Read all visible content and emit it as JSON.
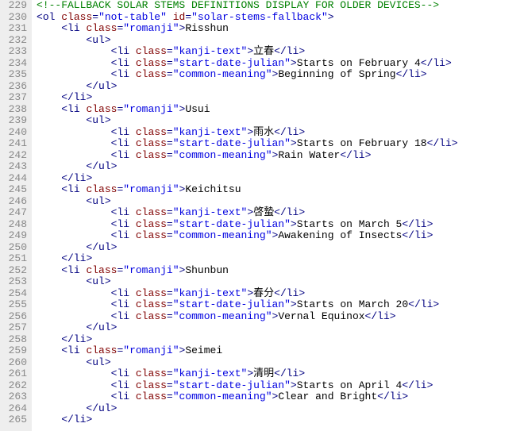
{
  "start_line_number": 229,
  "code_lines": [
    [
      {
        "t": "comment",
        "s": "<!--FALLBACK SOLAR STEMS DEFINITIONS DISPLAY FOR OLDER DEVICES-->"
      }
    ],
    [
      {
        "t": "punc",
        "s": "<"
      },
      {
        "t": "tag",
        "s": "ol"
      },
      {
        "t": "punc",
        "s": " "
      },
      {
        "t": "attr",
        "s": "class"
      },
      {
        "t": "punc",
        "s": "="
      },
      {
        "t": "str",
        "s": "\"not-table\""
      },
      {
        "t": "punc",
        "s": " "
      },
      {
        "t": "attr",
        "s": "id"
      },
      {
        "t": "punc",
        "s": "="
      },
      {
        "t": "str",
        "s": "\"solar-stems-fallback\""
      },
      {
        "t": "punc",
        "s": ">"
      }
    ],
    [
      {
        "t": "text",
        "s": "    "
      },
      {
        "t": "punc",
        "s": "<"
      },
      {
        "t": "tag",
        "s": "li"
      },
      {
        "t": "punc",
        "s": " "
      },
      {
        "t": "attr",
        "s": "class"
      },
      {
        "t": "punc",
        "s": "="
      },
      {
        "t": "str",
        "s": "\"romanji\""
      },
      {
        "t": "punc",
        "s": ">"
      },
      {
        "t": "text",
        "s": "Risshun"
      }
    ],
    [
      {
        "t": "text",
        "s": "        "
      },
      {
        "t": "punc",
        "s": "<"
      },
      {
        "t": "tag",
        "s": "ul"
      },
      {
        "t": "punc",
        "s": ">"
      }
    ],
    [
      {
        "t": "text",
        "s": "            "
      },
      {
        "t": "punc",
        "s": "<"
      },
      {
        "t": "tag",
        "s": "li"
      },
      {
        "t": "punc",
        "s": " "
      },
      {
        "t": "attr",
        "s": "class"
      },
      {
        "t": "punc",
        "s": "="
      },
      {
        "t": "str",
        "s": "\"kanji-text\""
      },
      {
        "t": "punc",
        "s": ">"
      },
      {
        "t": "text",
        "s": "立春"
      },
      {
        "t": "punc",
        "s": "</"
      },
      {
        "t": "tag",
        "s": "li"
      },
      {
        "t": "punc",
        "s": ">"
      }
    ],
    [
      {
        "t": "text",
        "s": "            "
      },
      {
        "t": "punc",
        "s": "<"
      },
      {
        "t": "tag",
        "s": "li"
      },
      {
        "t": "punc",
        "s": " "
      },
      {
        "t": "attr",
        "s": "class"
      },
      {
        "t": "punc",
        "s": "="
      },
      {
        "t": "str",
        "s": "\"start-date-julian\""
      },
      {
        "t": "punc",
        "s": ">"
      },
      {
        "t": "text",
        "s": "Starts on February 4"
      },
      {
        "t": "punc",
        "s": "</"
      },
      {
        "t": "tag",
        "s": "li"
      },
      {
        "t": "punc",
        "s": ">"
      }
    ],
    [
      {
        "t": "text",
        "s": "            "
      },
      {
        "t": "punc",
        "s": "<"
      },
      {
        "t": "tag",
        "s": "li"
      },
      {
        "t": "punc",
        "s": " "
      },
      {
        "t": "attr",
        "s": "class"
      },
      {
        "t": "punc",
        "s": "="
      },
      {
        "t": "str",
        "s": "\"common-meaning\""
      },
      {
        "t": "punc",
        "s": ">"
      },
      {
        "t": "text",
        "s": "Beginning of Spring"
      },
      {
        "t": "punc",
        "s": "</"
      },
      {
        "t": "tag",
        "s": "li"
      },
      {
        "t": "punc",
        "s": ">"
      }
    ],
    [
      {
        "t": "text",
        "s": "        "
      },
      {
        "t": "punc",
        "s": "</"
      },
      {
        "t": "tag",
        "s": "ul"
      },
      {
        "t": "punc",
        "s": ">"
      }
    ],
    [
      {
        "t": "text",
        "s": "    "
      },
      {
        "t": "punc",
        "s": "</"
      },
      {
        "t": "tag",
        "s": "li"
      },
      {
        "t": "punc",
        "s": ">"
      }
    ],
    [
      {
        "t": "text",
        "s": "    "
      },
      {
        "t": "punc",
        "s": "<"
      },
      {
        "t": "tag",
        "s": "li"
      },
      {
        "t": "punc",
        "s": " "
      },
      {
        "t": "attr",
        "s": "class"
      },
      {
        "t": "punc",
        "s": "="
      },
      {
        "t": "str",
        "s": "\"romanji\""
      },
      {
        "t": "punc",
        "s": ">"
      },
      {
        "t": "text",
        "s": "Usui"
      }
    ],
    [
      {
        "t": "text",
        "s": "        "
      },
      {
        "t": "punc",
        "s": "<"
      },
      {
        "t": "tag",
        "s": "ul"
      },
      {
        "t": "punc",
        "s": ">"
      }
    ],
    [
      {
        "t": "text",
        "s": "            "
      },
      {
        "t": "punc",
        "s": "<"
      },
      {
        "t": "tag",
        "s": "li"
      },
      {
        "t": "punc",
        "s": " "
      },
      {
        "t": "attr",
        "s": "class"
      },
      {
        "t": "punc",
        "s": "="
      },
      {
        "t": "str",
        "s": "\"kanji-text\""
      },
      {
        "t": "punc",
        "s": ">"
      },
      {
        "t": "text",
        "s": "雨水"
      },
      {
        "t": "punc",
        "s": "</"
      },
      {
        "t": "tag",
        "s": "li"
      },
      {
        "t": "punc",
        "s": ">"
      }
    ],
    [
      {
        "t": "text",
        "s": "            "
      },
      {
        "t": "punc",
        "s": "<"
      },
      {
        "t": "tag",
        "s": "li"
      },
      {
        "t": "punc",
        "s": " "
      },
      {
        "t": "attr",
        "s": "class"
      },
      {
        "t": "punc",
        "s": "="
      },
      {
        "t": "str",
        "s": "\"start-date-julian\""
      },
      {
        "t": "punc",
        "s": ">"
      },
      {
        "t": "text",
        "s": "Starts on February 18"
      },
      {
        "t": "punc",
        "s": "</"
      },
      {
        "t": "tag",
        "s": "li"
      },
      {
        "t": "punc",
        "s": ">"
      }
    ],
    [
      {
        "t": "text",
        "s": "            "
      },
      {
        "t": "punc",
        "s": "<"
      },
      {
        "t": "tag",
        "s": "li"
      },
      {
        "t": "punc",
        "s": " "
      },
      {
        "t": "attr",
        "s": "class"
      },
      {
        "t": "punc",
        "s": "="
      },
      {
        "t": "str",
        "s": "\"common-meaning\""
      },
      {
        "t": "punc",
        "s": ">"
      },
      {
        "t": "text",
        "s": "Rain Water"
      },
      {
        "t": "punc",
        "s": "</"
      },
      {
        "t": "tag",
        "s": "li"
      },
      {
        "t": "punc",
        "s": ">"
      }
    ],
    [
      {
        "t": "text",
        "s": "        "
      },
      {
        "t": "punc",
        "s": "</"
      },
      {
        "t": "tag",
        "s": "ul"
      },
      {
        "t": "punc",
        "s": ">"
      }
    ],
    [
      {
        "t": "text",
        "s": "    "
      },
      {
        "t": "punc",
        "s": "</"
      },
      {
        "t": "tag",
        "s": "li"
      },
      {
        "t": "punc",
        "s": ">"
      }
    ],
    [
      {
        "t": "text",
        "s": "    "
      },
      {
        "t": "punc",
        "s": "<"
      },
      {
        "t": "tag",
        "s": "li"
      },
      {
        "t": "punc",
        "s": " "
      },
      {
        "t": "attr",
        "s": "class"
      },
      {
        "t": "punc",
        "s": "="
      },
      {
        "t": "str",
        "s": "\"romanji\""
      },
      {
        "t": "punc",
        "s": ">"
      },
      {
        "t": "text",
        "s": "Keichitsu"
      }
    ],
    [
      {
        "t": "text",
        "s": "        "
      },
      {
        "t": "punc",
        "s": "<"
      },
      {
        "t": "tag",
        "s": "ul"
      },
      {
        "t": "punc",
        "s": ">"
      }
    ],
    [
      {
        "t": "text",
        "s": "            "
      },
      {
        "t": "punc",
        "s": "<"
      },
      {
        "t": "tag",
        "s": "li"
      },
      {
        "t": "punc",
        "s": " "
      },
      {
        "t": "attr",
        "s": "class"
      },
      {
        "t": "punc",
        "s": "="
      },
      {
        "t": "str",
        "s": "\"kanji-text\""
      },
      {
        "t": "punc",
        "s": ">"
      },
      {
        "t": "text",
        "s": "啓蟄"
      },
      {
        "t": "punc",
        "s": "</"
      },
      {
        "t": "tag",
        "s": "li"
      },
      {
        "t": "punc",
        "s": ">"
      }
    ],
    [
      {
        "t": "text",
        "s": "            "
      },
      {
        "t": "punc",
        "s": "<"
      },
      {
        "t": "tag",
        "s": "li"
      },
      {
        "t": "punc",
        "s": " "
      },
      {
        "t": "attr",
        "s": "class"
      },
      {
        "t": "punc",
        "s": "="
      },
      {
        "t": "str",
        "s": "\"start-date-julian\""
      },
      {
        "t": "punc",
        "s": ">"
      },
      {
        "t": "text",
        "s": "Starts on March 5"
      },
      {
        "t": "punc",
        "s": "</"
      },
      {
        "t": "tag",
        "s": "li"
      },
      {
        "t": "punc",
        "s": ">"
      }
    ],
    [
      {
        "t": "text",
        "s": "            "
      },
      {
        "t": "punc",
        "s": "<"
      },
      {
        "t": "tag",
        "s": "li"
      },
      {
        "t": "punc",
        "s": " "
      },
      {
        "t": "attr",
        "s": "class"
      },
      {
        "t": "punc",
        "s": "="
      },
      {
        "t": "str",
        "s": "\"common-meaning\""
      },
      {
        "t": "punc",
        "s": ">"
      },
      {
        "t": "text",
        "s": "Awakening of Insects"
      },
      {
        "t": "punc",
        "s": "</"
      },
      {
        "t": "tag",
        "s": "li"
      },
      {
        "t": "punc",
        "s": ">"
      }
    ],
    [
      {
        "t": "text",
        "s": "        "
      },
      {
        "t": "punc",
        "s": "</"
      },
      {
        "t": "tag",
        "s": "ul"
      },
      {
        "t": "punc",
        "s": ">"
      }
    ],
    [
      {
        "t": "text",
        "s": "    "
      },
      {
        "t": "punc",
        "s": "</"
      },
      {
        "t": "tag",
        "s": "li"
      },
      {
        "t": "punc",
        "s": ">"
      }
    ],
    [
      {
        "t": "text",
        "s": "    "
      },
      {
        "t": "punc",
        "s": "<"
      },
      {
        "t": "tag",
        "s": "li"
      },
      {
        "t": "punc",
        "s": " "
      },
      {
        "t": "attr",
        "s": "class"
      },
      {
        "t": "punc",
        "s": "="
      },
      {
        "t": "str",
        "s": "\"romanji\""
      },
      {
        "t": "punc",
        "s": ">"
      },
      {
        "t": "text",
        "s": "Shunbun"
      }
    ],
    [
      {
        "t": "text",
        "s": "        "
      },
      {
        "t": "punc",
        "s": "<"
      },
      {
        "t": "tag",
        "s": "ul"
      },
      {
        "t": "punc",
        "s": ">"
      }
    ],
    [
      {
        "t": "text",
        "s": "            "
      },
      {
        "t": "punc",
        "s": "<"
      },
      {
        "t": "tag",
        "s": "li"
      },
      {
        "t": "punc",
        "s": " "
      },
      {
        "t": "attr",
        "s": "class"
      },
      {
        "t": "punc",
        "s": "="
      },
      {
        "t": "str",
        "s": "\"kanji-text\""
      },
      {
        "t": "punc",
        "s": ">"
      },
      {
        "t": "text",
        "s": "春分"
      },
      {
        "t": "punc",
        "s": "</"
      },
      {
        "t": "tag",
        "s": "li"
      },
      {
        "t": "punc",
        "s": ">"
      }
    ],
    [
      {
        "t": "text",
        "s": "            "
      },
      {
        "t": "punc",
        "s": "<"
      },
      {
        "t": "tag",
        "s": "li"
      },
      {
        "t": "punc",
        "s": " "
      },
      {
        "t": "attr",
        "s": "class"
      },
      {
        "t": "punc",
        "s": "="
      },
      {
        "t": "str",
        "s": "\"start-date-julian\""
      },
      {
        "t": "punc",
        "s": ">"
      },
      {
        "t": "text",
        "s": "Starts on March 20"
      },
      {
        "t": "punc",
        "s": "</"
      },
      {
        "t": "tag",
        "s": "li"
      },
      {
        "t": "punc",
        "s": ">"
      }
    ],
    [
      {
        "t": "text",
        "s": "            "
      },
      {
        "t": "punc",
        "s": "<"
      },
      {
        "t": "tag",
        "s": "li"
      },
      {
        "t": "punc",
        "s": " "
      },
      {
        "t": "attr",
        "s": "class"
      },
      {
        "t": "punc",
        "s": "="
      },
      {
        "t": "str",
        "s": "\"common-meaning\""
      },
      {
        "t": "punc",
        "s": ">"
      },
      {
        "t": "text",
        "s": "Vernal Equinox"
      },
      {
        "t": "punc",
        "s": "</"
      },
      {
        "t": "tag",
        "s": "li"
      },
      {
        "t": "punc",
        "s": ">"
      }
    ],
    [
      {
        "t": "text",
        "s": "        "
      },
      {
        "t": "punc",
        "s": "</"
      },
      {
        "t": "tag",
        "s": "ul"
      },
      {
        "t": "punc",
        "s": ">"
      }
    ],
    [
      {
        "t": "text",
        "s": "    "
      },
      {
        "t": "punc",
        "s": "</"
      },
      {
        "t": "tag",
        "s": "li"
      },
      {
        "t": "punc",
        "s": ">"
      }
    ],
    [
      {
        "t": "text",
        "s": "    "
      },
      {
        "t": "punc",
        "s": "<"
      },
      {
        "t": "tag",
        "s": "li"
      },
      {
        "t": "punc",
        "s": " "
      },
      {
        "t": "attr",
        "s": "class"
      },
      {
        "t": "punc",
        "s": "="
      },
      {
        "t": "str",
        "s": "\"romanji\""
      },
      {
        "t": "punc",
        "s": ">"
      },
      {
        "t": "text",
        "s": "Seimei"
      }
    ],
    [
      {
        "t": "text",
        "s": "        "
      },
      {
        "t": "punc",
        "s": "<"
      },
      {
        "t": "tag",
        "s": "ul"
      },
      {
        "t": "punc",
        "s": ">"
      }
    ],
    [
      {
        "t": "text",
        "s": "            "
      },
      {
        "t": "punc",
        "s": "<"
      },
      {
        "t": "tag",
        "s": "li"
      },
      {
        "t": "punc",
        "s": " "
      },
      {
        "t": "attr",
        "s": "class"
      },
      {
        "t": "punc",
        "s": "="
      },
      {
        "t": "str",
        "s": "\"kanji-text\""
      },
      {
        "t": "punc",
        "s": ">"
      },
      {
        "t": "text",
        "s": "清明"
      },
      {
        "t": "punc",
        "s": "</"
      },
      {
        "t": "tag",
        "s": "li"
      },
      {
        "t": "punc",
        "s": ">"
      }
    ],
    [
      {
        "t": "text",
        "s": "            "
      },
      {
        "t": "punc",
        "s": "<"
      },
      {
        "t": "tag",
        "s": "li"
      },
      {
        "t": "punc",
        "s": " "
      },
      {
        "t": "attr",
        "s": "class"
      },
      {
        "t": "punc",
        "s": "="
      },
      {
        "t": "str",
        "s": "\"start-date-julian\""
      },
      {
        "t": "punc",
        "s": ">"
      },
      {
        "t": "text",
        "s": "Starts on April 4"
      },
      {
        "t": "punc",
        "s": "</"
      },
      {
        "t": "tag",
        "s": "li"
      },
      {
        "t": "punc",
        "s": ">"
      }
    ],
    [
      {
        "t": "text",
        "s": "            "
      },
      {
        "t": "punc",
        "s": "<"
      },
      {
        "t": "tag",
        "s": "li"
      },
      {
        "t": "punc",
        "s": " "
      },
      {
        "t": "attr",
        "s": "class"
      },
      {
        "t": "punc",
        "s": "="
      },
      {
        "t": "str",
        "s": "\"common-meaning\""
      },
      {
        "t": "punc",
        "s": ">"
      },
      {
        "t": "text",
        "s": "Clear and Bright"
      },
      {
        "t": "punc",
        "s": "</"
      },
      {
        "t": "tag",
        "s": "li"
      },
      {
        "t": "punc",
        "s": ">"
      }
    ],
    [
      {
        "t": "text",
        "s": "        "
      },
      {
        "t": "punc",
        "s": "</"
      },
      {
        "t": "tag",
        "s": "ul"
      },
      {
        "t": "punc",
        "s": ">"
      }
    ],
    [
      {
        "t": "text",
        "s": "    "
      },
      {
        "t": "punc",
        "s": "</"
      },
      {
        "t": "tag",
        "s": "li"
      },
      {
        "t": "punc",
        "s": ">"
      }
    ]
  ]
}
